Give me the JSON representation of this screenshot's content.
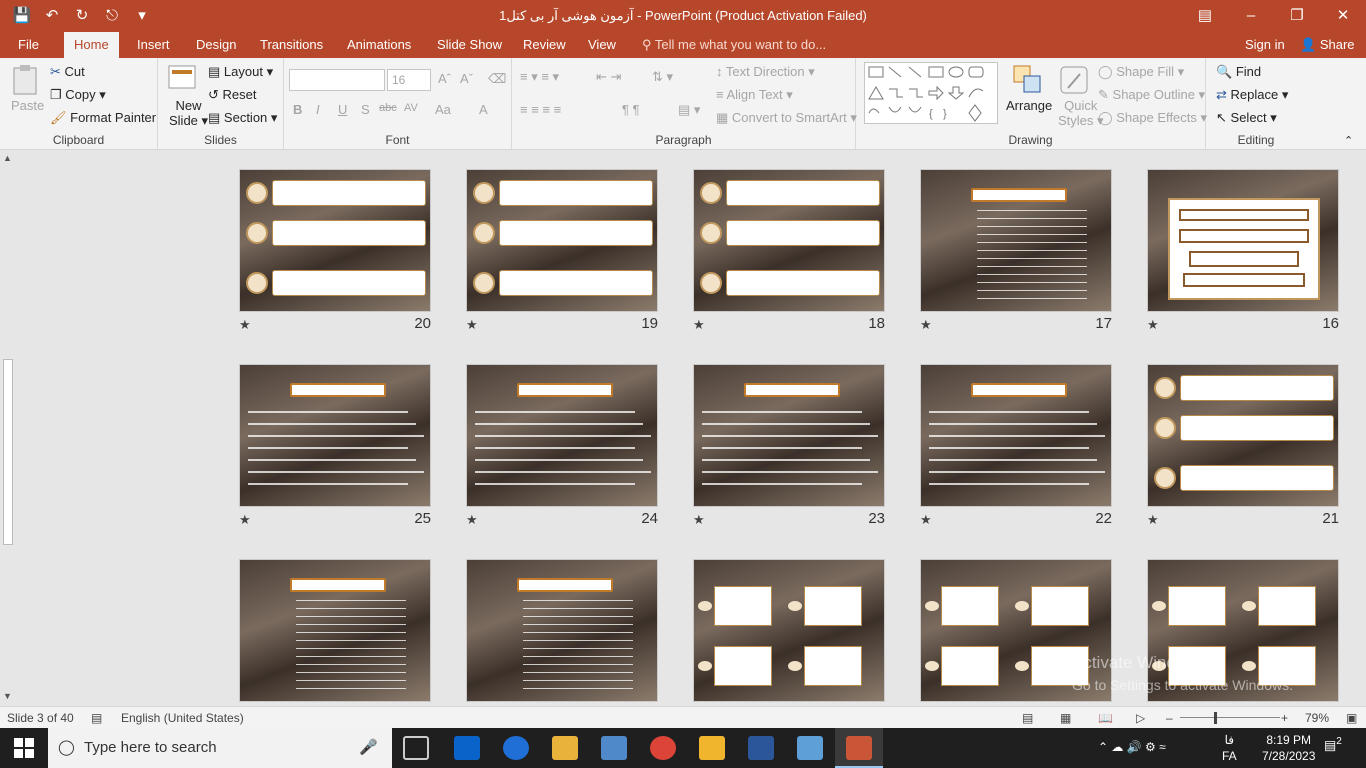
{
  "titlebar": {
    "title": "آزمون هوشی آر بی کتل1 - PowerPoint (Product Activation Failed)",
    "qat": [
      "save-icon",
      "undo-icon",
      "redo-icon",
      "presenter-icon",
      "customize-icon"
    ],
    "window_buttons": [
      "ribbon-display-icon",
      "minimize-icon",
      "restore-icon",
      "close-icon"
    ]
  },
  "tabs": [
    {
      "label": "File"
    },
    {
      "label": "Home"
    },
    {
      "label": "Insert"
    },
    {
      "label": "Design"
    },
    {
      "label": "Transitions"
    },
    {
      "label": "Animations"
    },
    {
      "label": "Slide Show"
    },
    {
      "label": "Review"
    },
    {
      "label": "View"
    }
  ],
  "tell_me": "Tell me what you want to do...",
  "sign_in": "Sign in",
  "share": "Share",
  "ribbon": {
    "clipboard": {
      "label": "Clipboard",
      "paste": "Paste",
      "cut": "Cut",
      "copy": "Copy",
      "format_painter": "Format Painter"
    },
    "slides": {
      "label": "Slides",
      "new_slide_1": "New",
      "new_slide_2": "Slide",
      "layout": "Layout",
      "reset": "Reset",
      "section": "Section"
    },
    "font": {
      "label": "Font",
      "font_name": "",
      "font_size": "16",
      "bold": "B",
      "italic": "I",
      "underline": "U",
      "shadow": "S",
      "strike": "abc",
      "spacing": "AV",
      "case": "Aa",
      "color": "A"
    },
    "paragraph": {
      "label": "Paragraph",
      "text_direction": "Text Direction",
      "align_text": "Align Text",
      "smartart": "Convert to SmartArt"
    },
    "drawing": {
      "label": "Drawing",
      "arrange": "Arrange",
      "quick_styles_1": "Quick",
      "quick_styles_2": "Styles",
      "shape_fill": "Shape Fill",
      "shape_outline": "Shape Outline",
      "shape_effects": "Shape Effects"
    },
    "editing": {
      "label": "Editing",
      "find": "Find",
      "replace": "Replace",
      "select": "Select"
    }
  },
  "slides_row1": [
    {
      "num": "20",
      "kind": "panels"
    },
    {
      "num": "19",
      "kind": "panels"
    },
    {
      "num": "18",
      "kind": "panels"
    },
    {
      "num": "17",
      "kind": "list"
    },
    {
      "num": "16",
      "kind": "maze"
    }
  ],
  "slides_row2": [
    {
      "num": "25",
      "kind": "text"
    },
    {
      "num": "24",
      "kind": "text"
    },
    {
      "num": "23",
      "kind": "text"
    },
    {
      "num": "22",
      "kind": "text"
    },
    {
      "num": "21",
      "kind": "panels"
    }
  ],
  "slides_row3": [
    {
      "num": "",
      "kind": "list"
    },
    {
      "num": "",
      "kind": "list"
    },
    {
      "num": "",
      "kind": "cards"
    },
    {
      "num": "",
      "kind": "cards"
    },
    {
      "num": "",
      "kind": "cards"
    }
  ],
  "star": "★",
  "status": {
    "slide_info": "Slide 3 of 40",
    "language": "English (United States)",
    "zoom": "79%"
  },
  "watermark": {
    "line1": "Activate Windows",
    "line2": "Go to Settings to activate Windows."
  },
  "taskbar": {
    "search_placeholder": "Type here to search",
    "lang": "FA",
    "time": "8:19 PM",
    "date": "7/28/2023",
    "notifications": "2",
    "ime": "فا"
  }
}
